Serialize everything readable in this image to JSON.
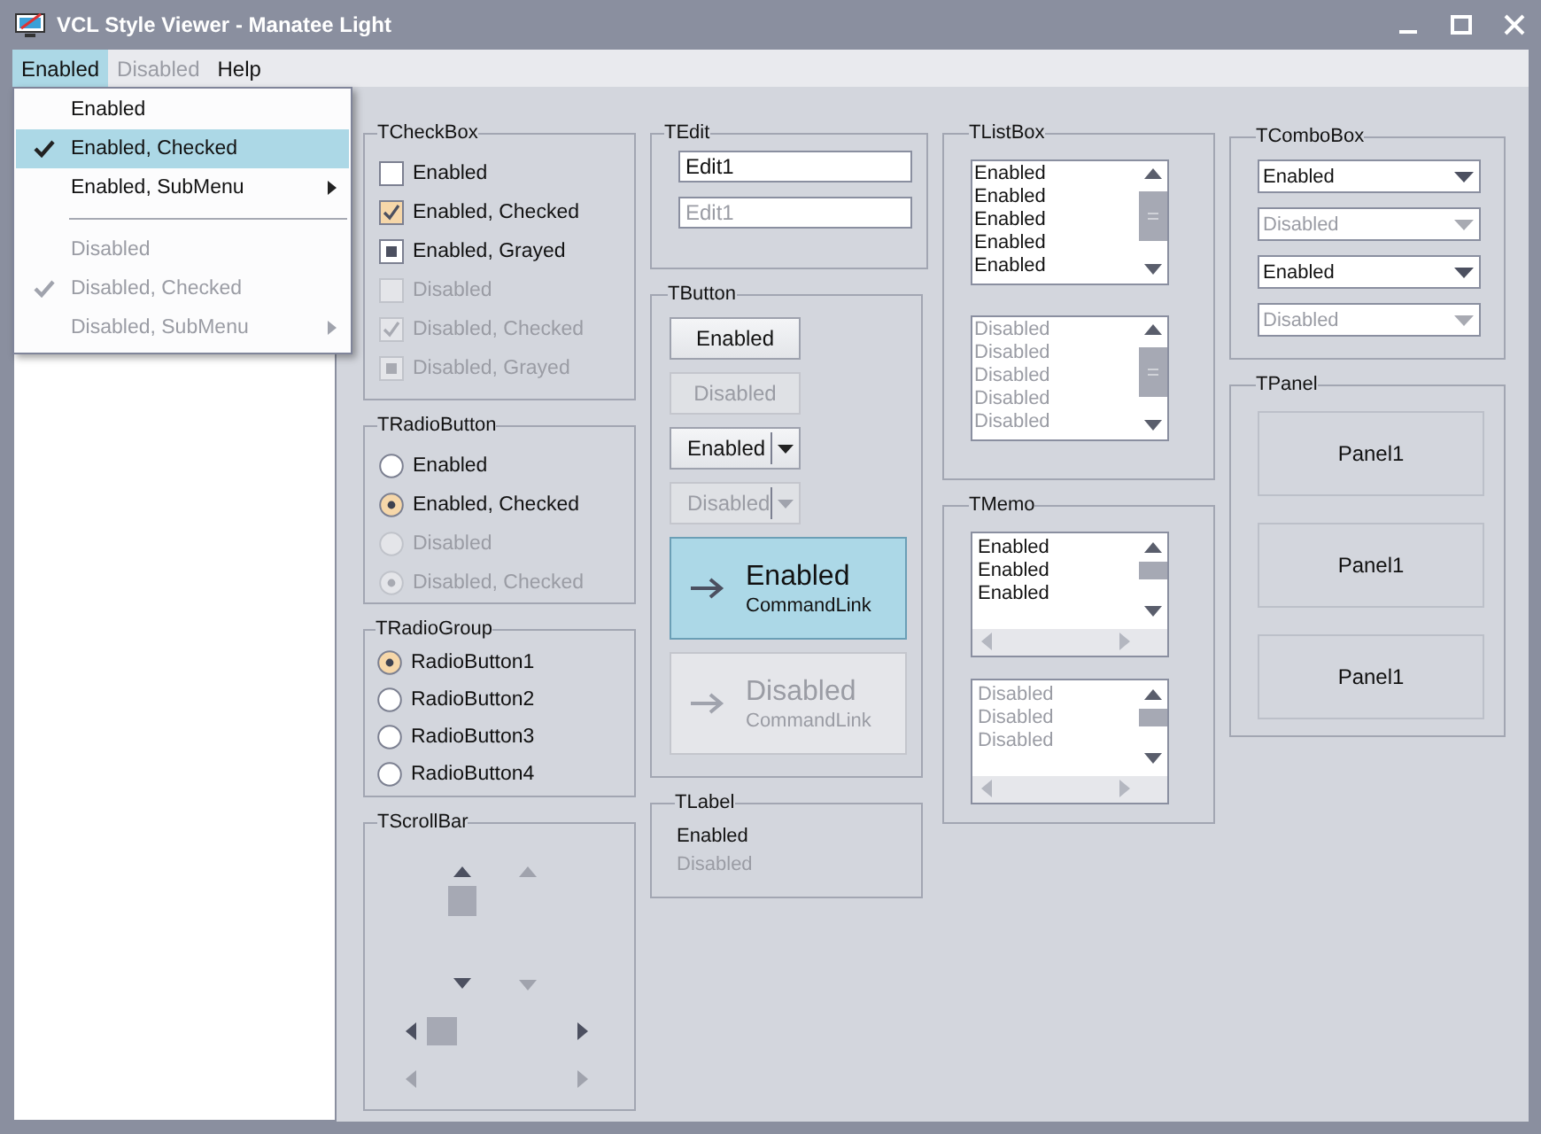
{
  "window": {
    "title": "VCL Style Viewer - Manatee Light"
  },
  "menu_bar": [
    {
      "label": "Enabled",
      "selected": true,
      "disabled": false
    },
    {
      "label": "Disabled",
      "selected": false,
      "disabled": true
    },
    {
      "label": "Help",
      "selected": false,
      "disabled": false
    }
  ],
  "menu": [
    {
      "kind": "item",
      "label": "Enabled",
      "checked": false,
      "disabled": false,
      "submenu": false,
      "selected": false
    },
    {
      "kind": "item",
      "label": "Enabled, Checked",
      "checked": true,
      "disabled": false,
      "submenu": false,
      "selected": true
    },
    {
      "kind": "item",
      "label": "Enabled, SubMenu",
      "checked": false,
      "disabled": false,
      "submenu": true,
      "selected": false
    },
    {
      "kind": "separator"
    },
    {
      "kind": "item",
      "label": "Disabled",
      "checked": false,
      "disabled": true,
      "submenu": false,
      "selected": false
    },
    {
      "kind": "item",
      "label": "Disabled, Checked",
      "checked": true,
      "disabled": true,
      "submenu": false,
      "selected": false
    },
    {
      "kind": "item",
      "label": "Disabled, SubMenu",
      "checked": false,
      "disabled": true,
      "submenu": true,
      "selected": false
    }
  ],
  "checkbox_group": {
    "title": "TCheckBox",
    "items": [
      {
        "label": "Enabled",
        "checked": false,
        "grayed": false,
        "disabled": false
      },
      {
        "label": "Enabled, Checked",
        "checked": true,
        "grayed": false,
        "disabled": false
      },
      {
        "label": "Enabled, Grayed",
        "checked": false,
        "grayed": true,
        "disabled": false
      },
      {
        "label": "Disabled",
        "checked": false,
        "grayed": false,
        "disabled": true
      },
      {
        "label": "Disabled, Checked",
        "checked": true,
        "grayed": false,
        "disabled": true
      },
      {
        "label": "Disabled, Grayed",
        "checked": false,
        "grayed": true,
        "disabled": true
      }
    ]
  },
  "radiobutton_group": {
    "title": "TRadioButton",
    "items": [
      {
        "label": "Enabled",
        "selected": false,
        "disabled": false
      },
      {
        "label": "Enabled, Checked",
        "selected": true,
        "disabled": false
      },
      {
        "label": "Disabled",
        "selected": false,
        "disabled": true
      },
      {
        "label": "Disabled, Checked",
        "selected": true,
        "disabled": true
      }
    ]
  },
  "radiogroup": {
    "title": "TRadioGroup",
    "items": [
      {
        "label": "RadioButton1",
        "selected": true
      },
      {
        "label": "RadioButton2",
        "selected": false
      },
      {
        "label": "RadioButton3",
        "selected": false
      },
      {
        "label": "RadioButton4",
        "selected": false
      }
    ]
  },
  "scrollbar_group": {
    "title": "TScrollBar"
  },
  "edit_group": {
    "title": "TEdit",
    "fields": [
      {
        "value": "Edit1",
        "disabled": false
      },
      {
        "value": "Edit1",
        "disabled": true
      }
    ]
  },
  "button_group": {
    "title": "TButton",
    "buttons": [
      {
        "kind": "button",
        "label": "Enabled",
        "disabled": false
      },
      {
        "kind": "button",
        "label": "Disabled",
        "disabled": true
      },
      {
        "kind": "split",
        "label": "Enabled",
        "disabled": false
      },
      {
        "kind": "split",
        "label": "Disabled",
        "disabled": true
      },
      {
        "kind": "commandlink",
        "label": "Enabled",
        "note": "CommandLink",
        "disabled": false
      },
      {
        "kind": "commandlink",
        "label": "Disabled",
        "note": "CommandLink",
        "disabled": true
      }
    ]
  },
  "label_group": {
    "title": "TLabel",
    "labels": [
      {
        "text": "Enabled",
        "disabled": false
      },
      {
        "text": "Disabled",
        "disabled": true
      }
    ]
  },
  "listbox_group": {
    "title": "TListBox",
    "lists": [
      {
        "disabled": false,
        "items": [
          "Enabled",
          "Enabled",
          "Enabled",
          "Enabled",
          "Enabled"
        ]
      },
      {
        "disabled": true,
        "items": [
          "Disabled",
          "Disabled",
          "Disabled",
          "Disabled",
          "Disabled"
        ]
      }
    ]
  },
  "memo_group": {
    "title": "TMemo",
    "memos": [
      {
        "disabled": false,
        "lines": [
          "Enabled",
          "Enabled",
          "Enabled"
        ]
      },
      {
        "disabled": true,
        "lines": [
          "Disabled",
          "Disabled",
          "Disabled"
        ]
      }
    ]
  },
  "combobox_group": {
    "title": "TComboBox",
    "combos": [
      {
        "value": "Enabled",
        "disabled": false
      },
      {
        "value": "Disabled",
        "disabled": true
      },
      {
        "value": "Enabled",
        "disabled": false
      },
      {
        "value": "Disabled",
        "disabled": true
      }
    ]
  },
  "panel_group": {
    "title": "TPanel",
    "panels": [
      "Panel1",
      "Panel1",
      "Panel1"
    ]
  }
}
